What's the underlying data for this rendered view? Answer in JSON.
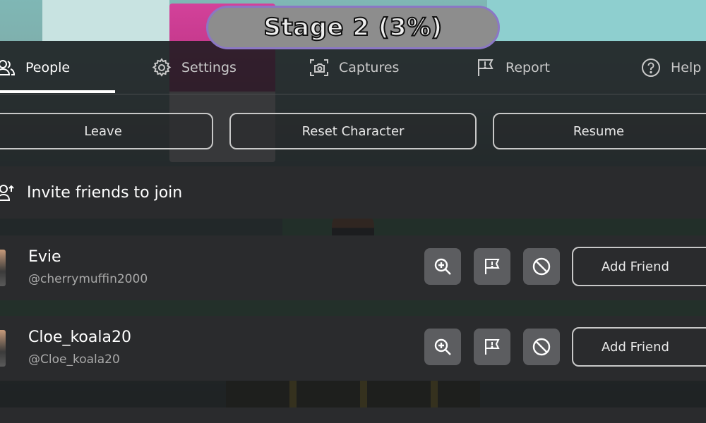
{
  "hud": {
    "stage_label": "Stage 2 (3%)"
  },
  "tabs": [
    {
      "label": "People",
      "icon": "people-icon",
      "active": true
    },
    {
      "label": "Settings",
      "icon": "gear-icon",
      "active": false
    },
    {
      "label": "Captures",
      "icon": "camera-icon",
      "active": false
    },
    {
      "label": "Report",
      "icon": "flag-icon",
      "active": false
    },
    {
      "label": "Help",
      "icon": "help-icon",
      "active": false
    }
  ],
  "actions": {
    "leave": "Leave",
    "reset": "Reset Character",
    "resume": "Resume"
  },
  "invite": {
    "label": "Invite friends to join"
  },
  "players": [
    {
      "name": "Evie",
      "handle": "@cherrymuffin2000",
      "add_friend": "Add Friend"
    },
    {
      "name": "Cloe_koala20",
      "handle": "@Cloe_koala20",
      "add_friend": "Add Friend"
    }
  ],
  "colors": {
    "overlay": "#1a1b1d",
    "row": "#2a2b2d",
    "icon_button": "#5c5d60",
    "stage_border": "#8b77c4"
  }
}
